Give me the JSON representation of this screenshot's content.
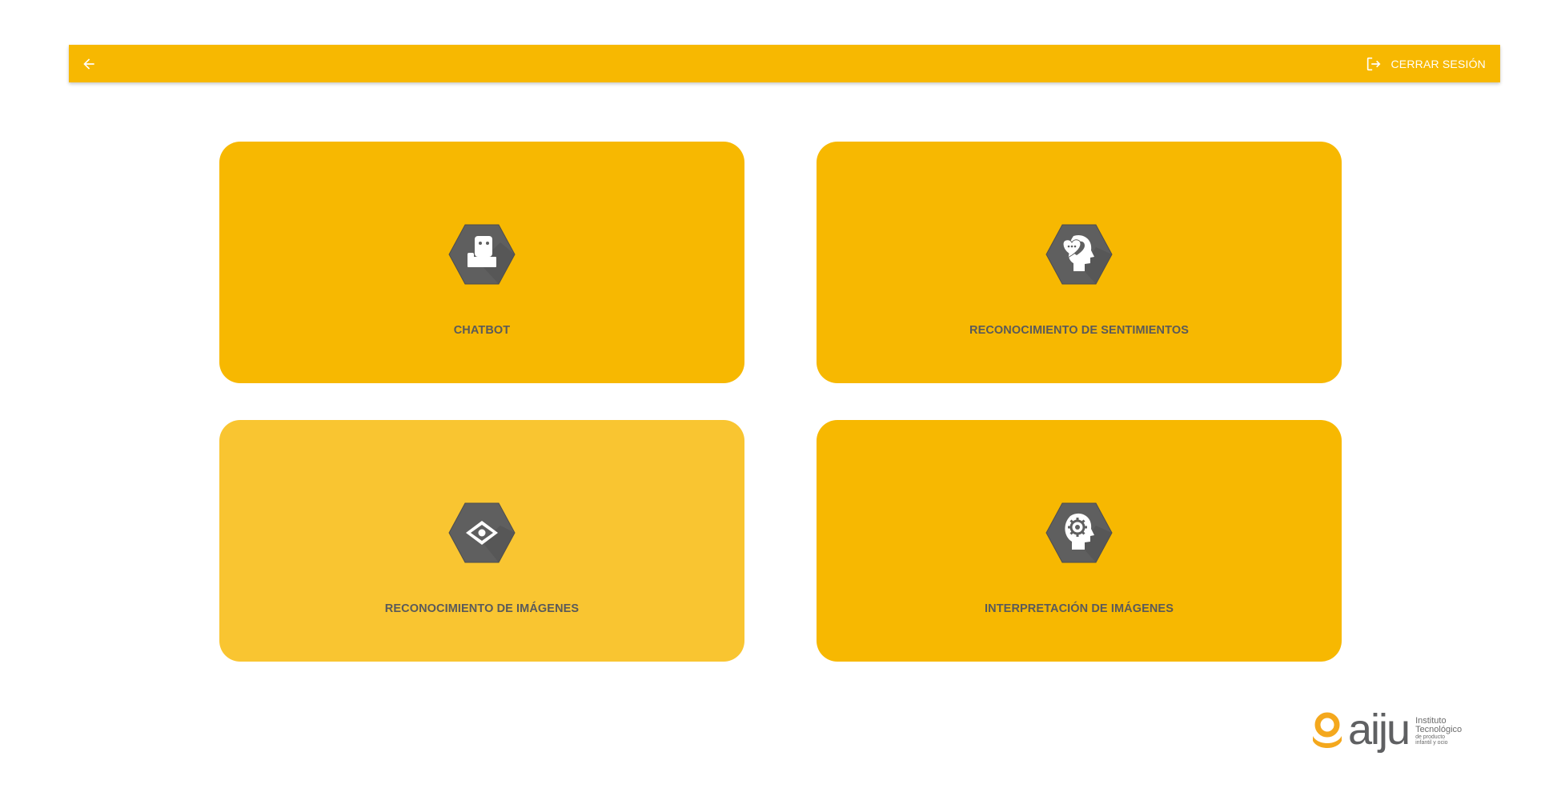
{
  "toolbar": {
    "back_icon": "arrow-left-icon",
    "logout_icon": "logout-icon",
    "logout_label": "CERRAR SESIÓN",
    "color": "#f7b801"
  },
  "cards": [
    {
      "label": "CHATBOT",
      "icon": "robot-hexagon-icon",
      "highlighted": false
    },
    {
      "label": "RECONOCIMIENTO DE SENTIMIENTOS",
      "icon": "head-heart-chat-hexagon-icon",
      "highlighted": false
    },
    {
      "label": "RECONOCIMIENTO DE IMÁGENES",
      "icon": "eye-hexagon-icon",
      "highlighted": true
    },
    {
      "label": "INTERPRETACIÓN DE IMÁGENES",
      "icon": "head-gear-hexagon-icon",
      "highlighted": false
    }
  ],
  "colors": {
    "card": "#f7b801",
    "card_hover": "#f9c531",
    "card_text": "#5a5a5a",
    "hexagon": "#5f5f5f",
    "logo_orange": "#f4a81d",
    "logo_gray": "#5f6062"
  },
  "logo": {
    "word": "aiju",
    "tagline_1": "Instituto",
    "tagline_2": "Tecnológico",
    "tagline_3": "de producto",
    "tagline_4": "infantil y ocio"
  }
}
